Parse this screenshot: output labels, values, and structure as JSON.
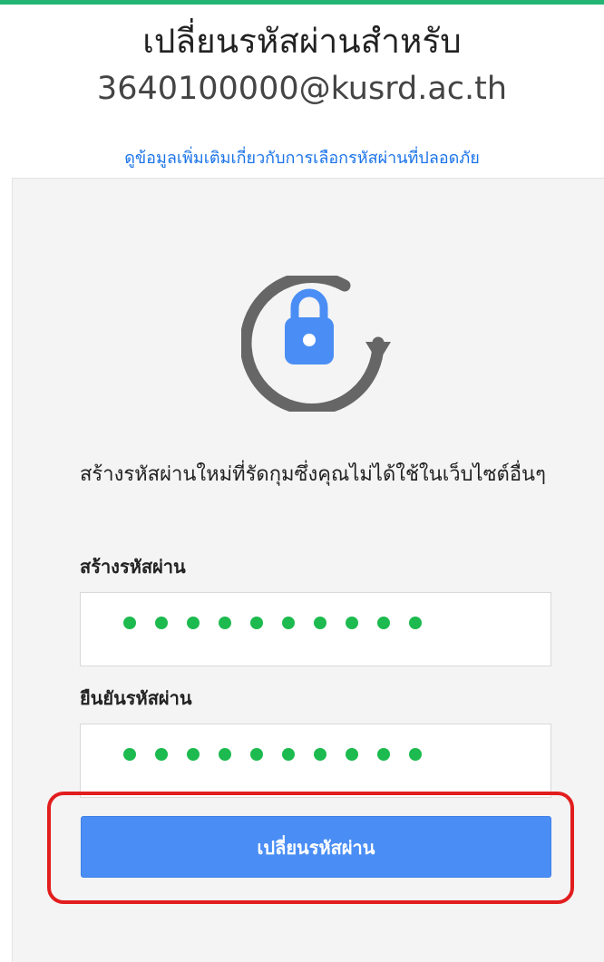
{
  "header": {
    "title": "เปลี่ยนรหัสผ่านสำหรับ",
    "email": "3640100000@kusrd.ac.th",
    "help_link": "ดูข้อมูลเพิ่มเติมเกี่ยวกับการเลือกรหัสผ่านที่ปลอดภัย"
  },
  "form": {
    "lock_icon": "lock-refresh-icon",
    "instructions": "สร้างรหัสผ่านใหม่ที่รัดกุมซึ่งคุณไม่ได้ใช้ในเว็บไซต์อื่นๆ",
    "new_password_label": "สร้างรหัสผ่าน",
    "confirm_password_label": "ยืนยันรหัสผ่าน",
    "submit_label": "เปลี่ยนรหัสผ่าน",
    "masked_dot_count": 10
  },
  "colors": {
    "accent_bar": "#22b573",
    "primary_button": "#4a8ef5",
    "mask_dots": "#1dba4f",
    "highlight": "#e21d1d",
    "link": "#1a73e8"
  }
}
